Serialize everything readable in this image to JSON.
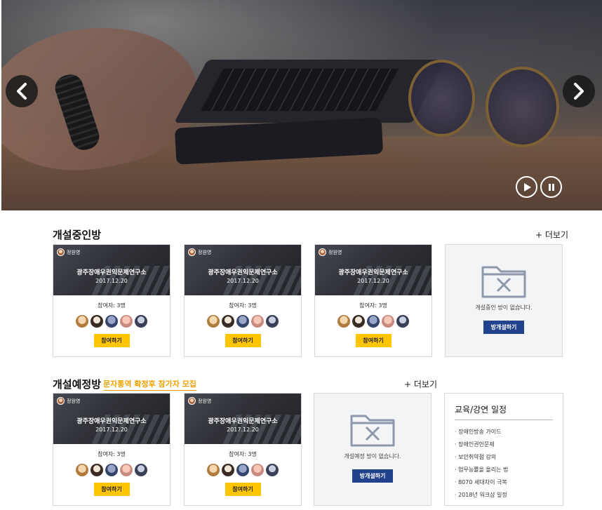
{
  "hero": {
    "prev_icon": "chevron-left-icon",
    "next_icon": "chevron-right-icon",
    "play_icon": "play-icon",
    "pause_icon": "pause-icon"
  },
  "open_rooms": {
    "title": "개설중인방",
    "more": "+ 더보기",
    "cards": [
      {
        "host": "정원영",
        "org": "광주장애우권익문제연구소",
        "date": "2017.12.20",
        "participants": "참여자: 3명",
        "join": "참여하기"
      },
      {
        "host": "정원영",
        "org": "광주장애우권익문제연구소",
        "date": "2017.12.20",
        "participants": "참여자: 3명",
        "join": "참여하기"
      },
      {
        "host": "정원영",
        "org": "광주장애우권익문제연구소",
        "date": "2017.12.20",
        "participants": "참여자: 3명",
        "join": "참여하기"
      }
    ],
    "empty": {
      "message": "개설중인 방이 없습니다.",
      "button": "방개설하기"
    }
  },
  "scheduled_rooms": {
    "title": "개설예정방",
    "subtitle": "문자통역 확정후 참가자 모집",
    "more": "+ 더보기",
    "cards": [
      {
        "host": "정원영",
        "org": "광주장애우권익문제연구소",
        "date": "2017.12.20",
        "participants": "참여자: 3명",
        "join": "참여하기"
      },
      {
        "host": "정원영",
        "org": "광주장애우권익문제연구소",
        "date": "2017.12.20",
        "participants": "참여자: 3명",
        "join": "참여하기"
      }
    ],
    "empty": {
      "message": "개설예정 방이 없습니다.",
      "button": "방개설하기"
    }
  },
  "schedule": {
    "title": "교육/강연 일정",
    "items": [
      "장애인방송 가이드",
      "장애인권인문제",
      "보안취약점 강의",
      "업무능률을 올리는 법",
      "8070 세대차이 극복",
      "2018년 워크샵 일정"
    ]
  },
  "colors": {
    "join_button": "#ffc600",
    "create_button": "#23428d",
    "subtitle_accent": "#f0a000"
  }
}
